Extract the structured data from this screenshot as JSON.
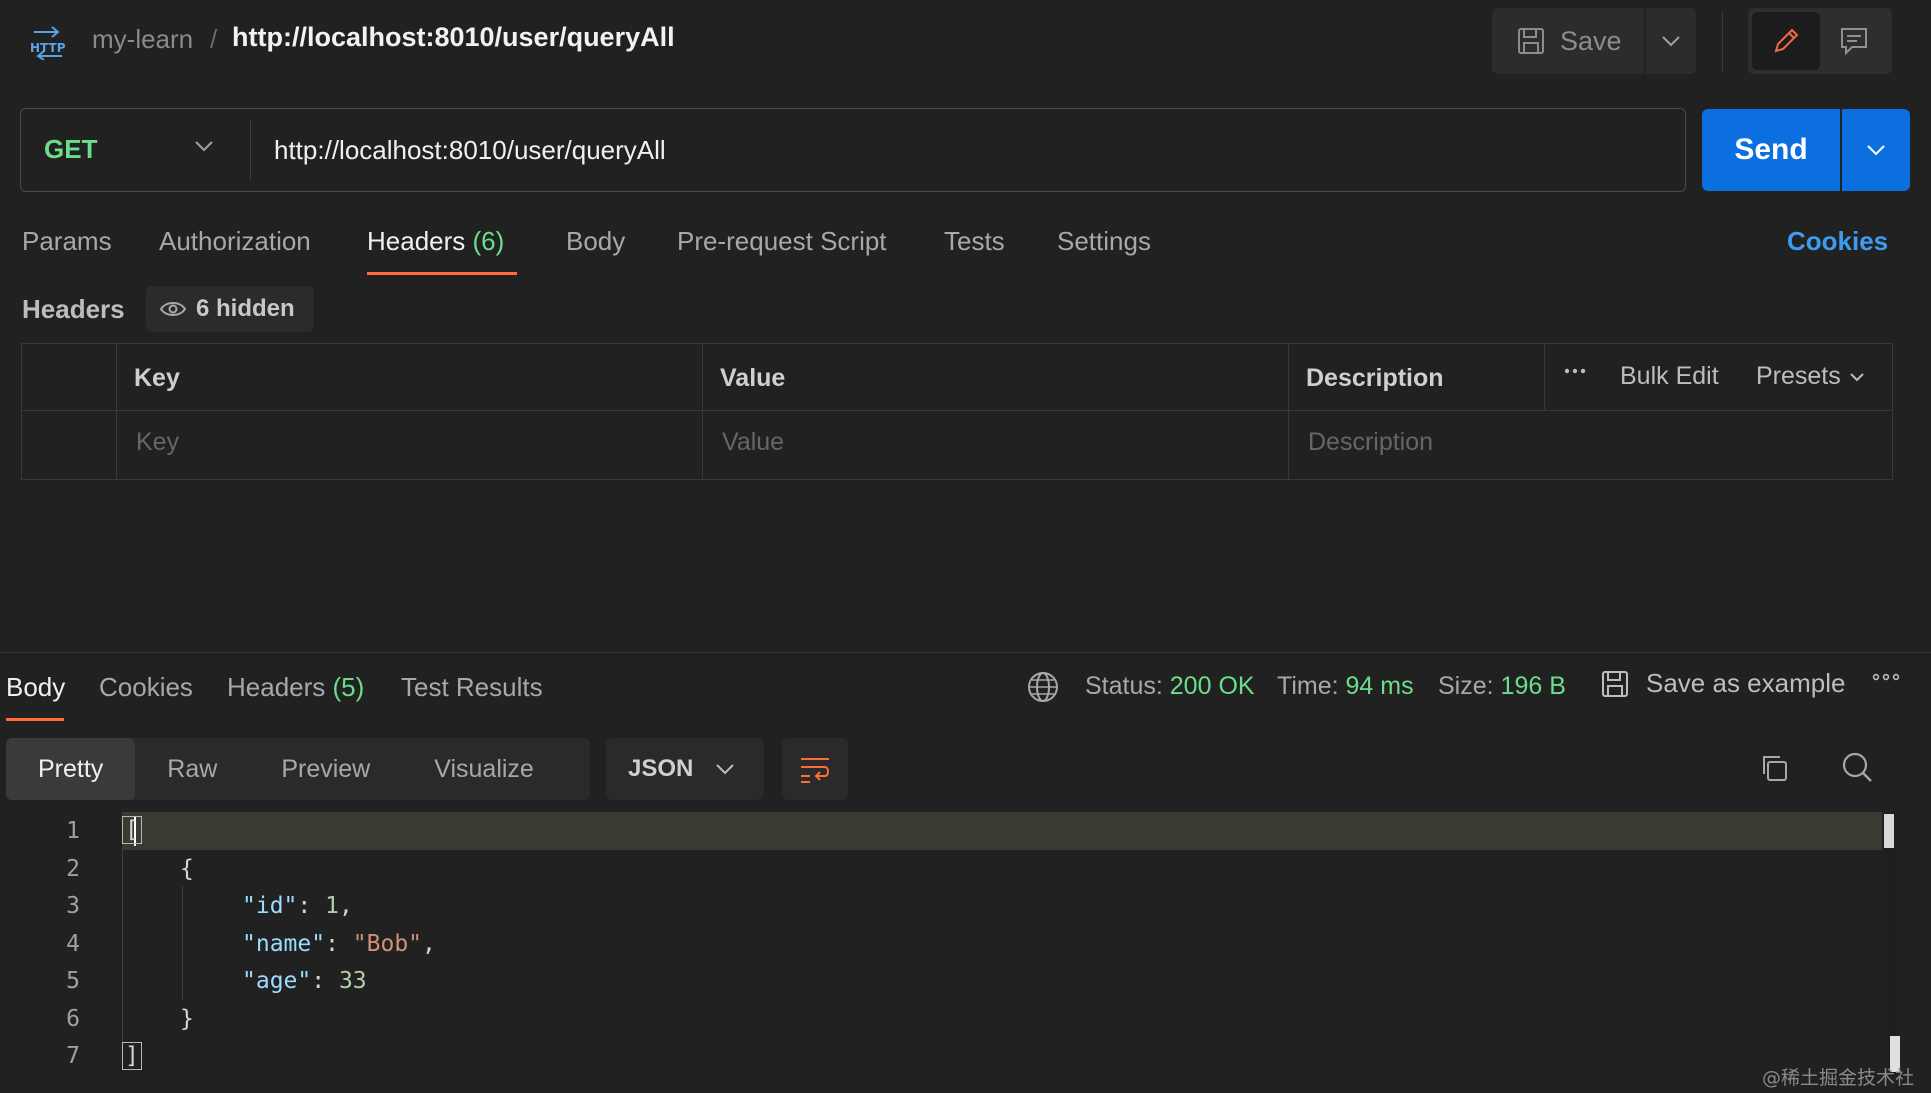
{
  "header": {
    "icon": "http-icon",
    "collection": "my-learn",
    "separator": "/",
    "title": "http://localhost:8010/user/queryAll",
    "save_label": "Save"
  },
  "request": {
    "method": "GET",
    "url": "http://localhost:8010/user/queryAll",
    "send_label": "Send"
  },
  "request_tabs": [
    {
      "label": "Params"
    },
    {
      "label": "Authorization"
    },
    {
      "label": "Headers",
      "count": "(6)",
      "active": true
    },
    {
      "label": "Body"
    },
    {
      "label": "Pre-request Script"
    },
    {
      "label": "Tests"
    },
    {
      "label": "Settings"
    }
  ],
  "cookies_link": "Cookies",
  "headers_section": {
    "title": "Headers",
    "hidden_label": "6 hidden",
    "columns": [
      "Key",
      "Value",
      "Description"
    ],
    "bulk_edit": "Bulk Edit",
    "presets": "Presets",
    "placeholders": {
      "key": "Key",
      "value": "Value",
      "description": "Description"
    }
  },
  "response_tabs": [
    {
      "label": "Body",
      "active": true
    },
    {
      "label": "Cookies"
    },
    {
      "label": "Headers",
      "count": "(5)"
    },
    {
      "label": "Test Results"
    }
  ],
  "response_status": {
    "status_label": "Status:",
    "status": "200 OK",
    "time_label": "Time:",
    "time": "94 ms",
    "size_label": "Size:",
    "size": "196 B",
    "save_example": "Save as example"
  },
  "format_tabs": [
    "Pretty",
    "Raw",
    "Preview",
    "Visualize"
  ],
  "active_format": "Pretty",
  "language": "JSON",
  "code": {
    "line_numbers": [
      "1",
      "2",
      "3",
      "4",
      "5",
      "6",
      "7"
    ],
    "lines": [
      "[",
      "{",
      "\"id\": 1,",
      "\"name\": \"Bob\",",
      "\"age\": 33",
      "}",
      "]"
    ],
    "tokens": {
      "open_bracket": "[",
      "open_brace": "{",
      "id_key": "\"id\"",
      "id_val": "1",
      "name_key": "\"name\"",
      "name_val": "\"Bob\"",
      "age_key": "\"age\"",
      "age_val": "33",
      "close_brace": "}",
      "close_bracket": "]"
    }
  },
  "watermark": "@稀土掘金技术社区",
  "colors": {
    "background": "#212121",
    "accent_blue": "#0b6fe0",
    "success_green": "#6bdd8b",
    "tab_underline": "#ff6c37",
    "link_blue": "#3d9cf2"
  }
}
